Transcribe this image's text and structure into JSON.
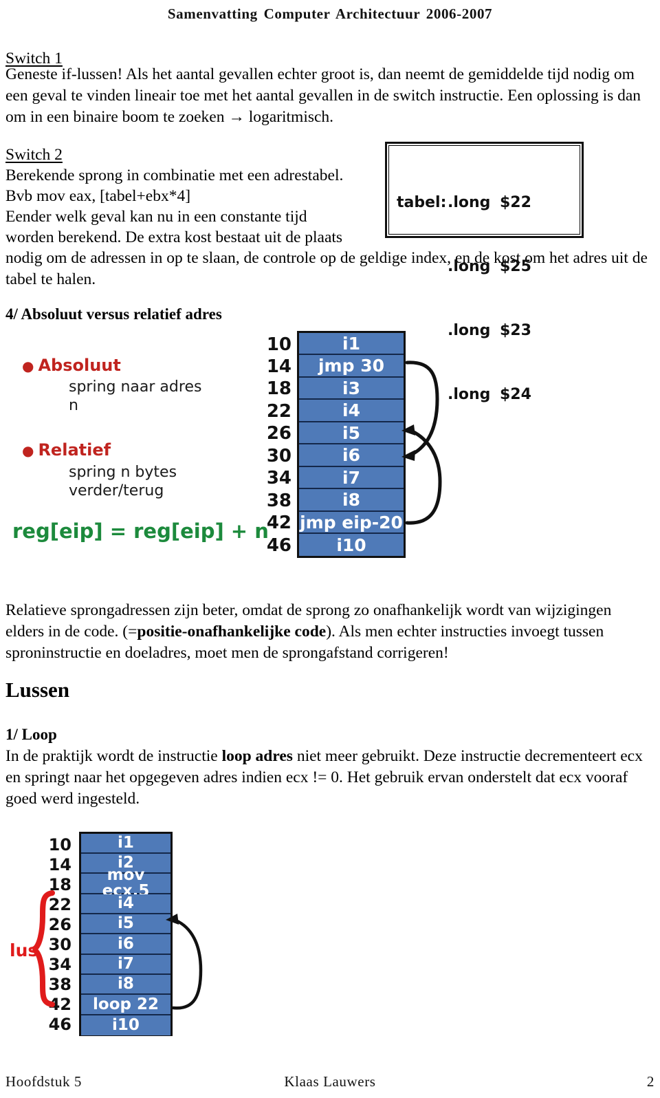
{
  "header": {
    "title": "Samenvatting Computer Architectuur 2006-2007"
  },
  "sections": {
    "switch1": {
      "heading": "Switch 1",
      "paragraph": "Geneste if-lussen! Als het aantal gevallen echter groot is, dan neemt de gemiddelde tijd nodig om een geval te vinden lineair toe met het aantal gevallen in de switch instructie. Een oplossing is dan om in een binaire boom te zoeken → logaritmisch."
    },
    "switch2": {
      "heading": "Switch 2",
      "line1": "Berekende sprong in combinatie met een adrestabel.",
      "line2": "Bvb mov eax, [tabel+ebx*4]",
      "line3": "Eender welk geval kan nu in een constante tijd",
      "line4": "worden berekend. De extra kost bestaat uit de plaats",
      "line5": "nodig om de adressen in op te slaan, de controle op de geldige index, en de kost om het adres uit de tabel te halen."
    },
    "absrel": {
      "heading": "4/ Absoluut versus relatief adres",
      "paragraph_part1": "Relatieve sprongadressen zijn beter, omdat de sprong zo onafhankelijk wordt van wijzigingen elders in de code. (=",
      "paragraph_bold": "positie-onafhankelijke code",
      "paragraph_part2": "). Als men echter instructies invoegt tussen sproninstructie en doeladres, moet men de sprongafstand corrigeren!"
    },
    "lussen": {
      "heading": "Lussen"
    },
    "loop": {
      "heading": "1/ Loop",
      "paragraph_part1": "In de praktijk wordt de instructie ",
      "paragraph_bold": "loop adres",
      "paragraph_part2": " niet meer gebruikt. Deze instructie decrementeert ecx en springt naar het opgegeven adres indien ecx != 0. Het gebruik ervan onderstelt dat ecx vooraf goed werd ingesteld."
    }
  },
  "tabel_figure": {
    "label": "tabel:",
    "rows": [
      {
        "label": "tabel:",
        "directive": ".long",
        "value": "$22"
      },
      {
        "label": "",
        "directive": ".long",
        "value": "$25"
      },
      {
        "label": "",
        "directive": ".long",
        "value": "$23"
      },
      {
        "label": "",
        "directive": ".long",
        "value": "$24"
      }
    ]
  },
  "slide_absrel": {
    "bullet1": "Absoluut",
    "bullet1_sub": "spring naar adres\nn",
    "bullet2": "Relatief",
    "bullet2_sub": "spring n bytes\nverder/terug",
    "formula": "reg[eip] = reg[eip] + n",
    "colors": {
      "bullet": "#c0241f",
      "formula": "#1c8a3c",
      "cell_fill": "#4f7ab8",
      "cell_border": "#14284a"
    },
    "memory": {
      "addresses": [
        "10",
        "14",
        "18",
        "22",
        "26",
        "30",
        "34",
        "38",
        "42",
        "46"
      ],
      "instructions": [
        "i1",
        "jmp 30",
        "i3",
        "i4",
        "i5",
        "i6",
        "i7",
        "i8",
        "jmp eip-20",
        "i10"
      ]
    }
  },
  "slide_loop": {
    "bracket_label": "lus",
    "colors": {
      "bracket": "#e01b1b",
      "cell_fill": "#4f7ab8",
      "cell_border": "#14284a"
    },
    "memory": {
      "addresses": [
        "10",
        "14",
        "18",
        "22",
        "26",
        "30",
        "34",
        "38",
        "42",
        "46"
      ],
      "instructions": [
        "i1",
        "i2",
        "mov ecx,5",
        "i4",
        "i5",
        "i6",
        "i7",
        "i8",
        "loop 22",
        "i10"
      ]
    }
  },
  "footer": {
    "left": "Hoofdstuk 5",
    "center": "Klaas Lauwers",
    "right": "2"
  }
}
